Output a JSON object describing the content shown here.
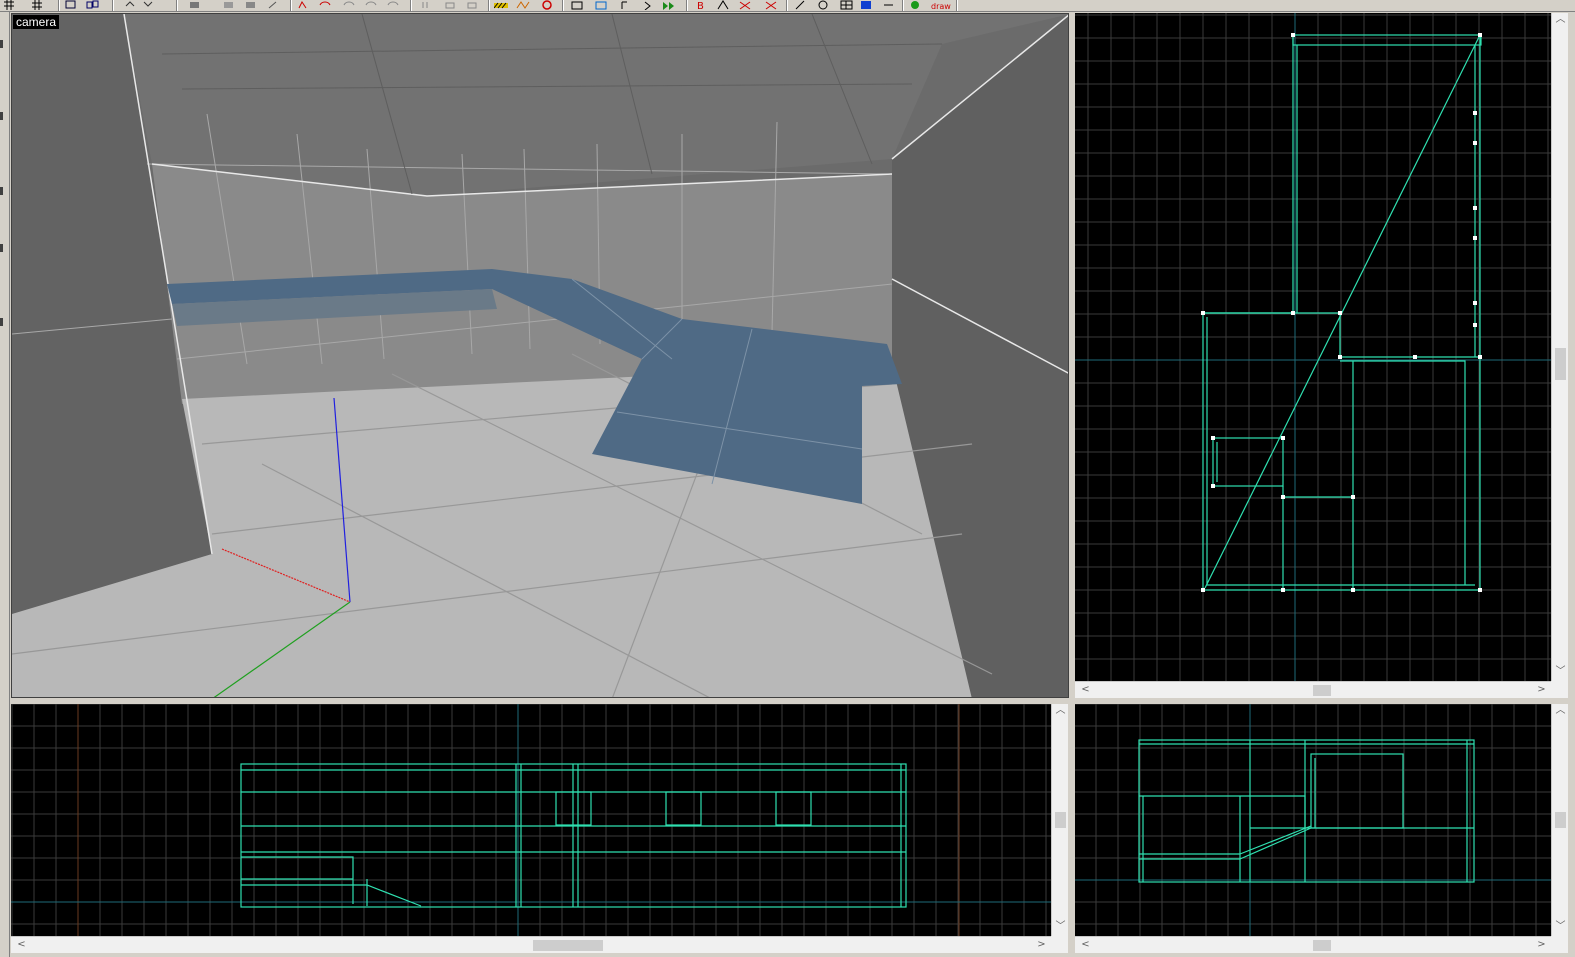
{
  "camera_view": {
    "label": "camera"
  },
  "icons": {
    "toolbar": [
      "grid-icon",
      "grid-size-icon",
      "select-icon",
      "entity-icon",
      "undo-icon",
      "redo-icon",
      "rotate-icon",
      "scale-icon",
      "clip-icon",
      "texture-lock-icon",
      "csg-subtract-icon",
      "csg-merge-icon",
      "hollow-icon",
      "brush-icon",
      "patch-icon",
      "light-icon",
      "cubic-clip-icon",
      "filter-icon",
      "draw-icon"
    ],
    "scrollbar_up": "▲",
    "scrollbar_down": "▼",
    "scrollbar_left": "◀",
    "scrollbar_right": "▶"
  },
  "scrollbar_arrows": {
    "up": "︿",
    "down": "﹀",
    "left": "<",
    "right": ">"
  },
  "colors": {
    "brush_outline": "#2fe0b0",
    "grid_line": "#3a3a3a",
    "grid_major": "#5a5a5a",
    "axis_line": "#1e6a78",
    "camera_bg": "#6b6b6b",
    "selected_face": "#4f6a85"
  }
}
